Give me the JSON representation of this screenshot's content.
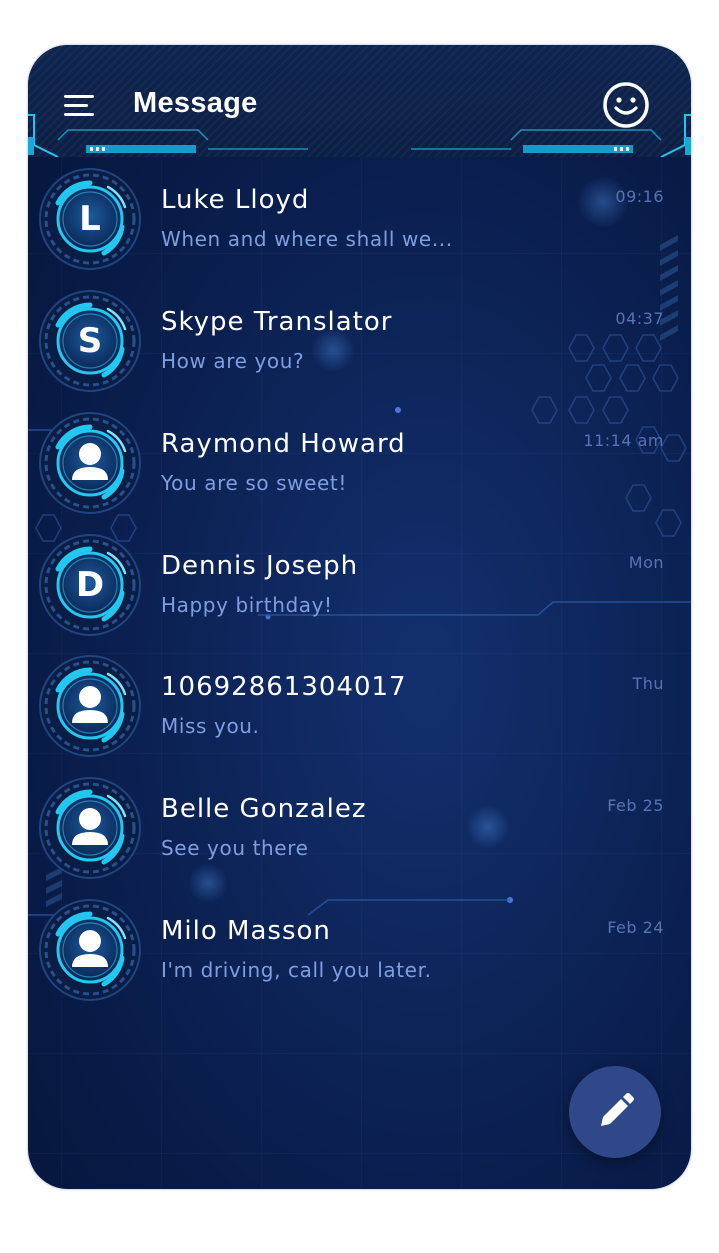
{
  "header": {
    "title": "Message",
    "menu_icon": "hamburger-menu-icon",
    "smiley_icon": "smiley-face-icon"
  },
  "colors": {
    "background": "#0b1f4d",
    "accent": "#22c8f0",
    "preview_text": "#7f9ee0",
    "time_text": "#5773b4",
    "fab": "#2f4889"
  },
  "conversations": [
    {
      "avatar_letter": "L",
      "avatar_type": "letter",
      "name": "Luke Lloyd",
      "preview": "When and where shall we...",
      "time": "09:16"
    },
    {
      "avatar_letter": "S",
      "avatar_type": "letter",
      "name": "Skype Translator",
      "preview": "How are you?",
      "time": "04:37"
    },
    {
      "avatar_letter": "",
      "avatar_type": "person-icon",
      "name": "Raymond Howard",
      "preview": "You are so sweet!",
      "time": "11:14 am"
    },
    {
      "avatar_letter": "D",
      "avatar_type": "letter",
      "name": "Dennis Joseph",
      "preview": "Happy birthday!",
      "time": "Mon"
    },
    {
      "avatar_letter": "",
      "avatar_type": "person-icon",
      "name": "10692861304017",
      "preview": "Miss you.",
      "time": "Thu"
    },
    {
      "avatar_letter": "",
      "avatar_type": "person-icon",
      "name": "Belle Gonzalez",
      "preview": "See you there",
      "time": "Feb 25"
    },
    {
      "avatar_letter": "",
      "avatar_type": "person-icon",
      "name": "Milo Masson",
      "preview": "I'm driving, call you later.",
      "time": "Feb 24"
    }
  ],
  "fab": {
    "icon": "pencil-compose-icon"
  }
}
